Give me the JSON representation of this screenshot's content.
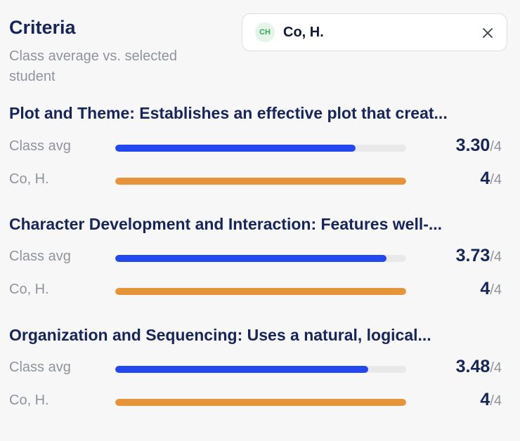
{
  "header": {
    "title": "Criteria",
    "subtitle": "Class average vs. selected student"
  },
  "student_selector": {
    "initials": "CH",
    "name": "Co, H.",
    "close_icon": "close-icon"
  },
  "colors": {
    "class_avg_bar": "#2347f0",
    "student_bar": "#e5943a",
    "track": "#e9e9e9"
  },
  "criteria": [
    {
      "title": "Plot and Theme: Establishes an effective plot that creat...",
      "class_avg": {
        "label": "Class avg",
        "value": "3.30",
        "max": "/4",
        "fraction": 0.825
      },
      "student": {
        "label": "Co, H.",
        "value": "4",
        "max": "/4",
        "fraction": 1.0
      }
    },
    {
      "title": "Character Development and Interaction: Features well-...",
      "class_avg": {
        "label": "Class avg",
        "value": "3.73",
        "max": "/4",
        "fraction": 0.9325
      },
      "student": {
        "label": "Co, H.",
        "value": "4",
        "max": "/4",
        "fraction": 1.0
      }
    },
    {
      "title": "Organization and Sequencing: Uses a natural, logical...",
      "class_avg": {
        "label": "Class avg",
        "value": "3.48",
        "max": "/4",
        "fraction": 0.87
      },
      "student": {
        "label": "Co, H.",
        "value": "4",
        "max": "/4",
        "fraction": 1.0
      }
    }
  ]
}
